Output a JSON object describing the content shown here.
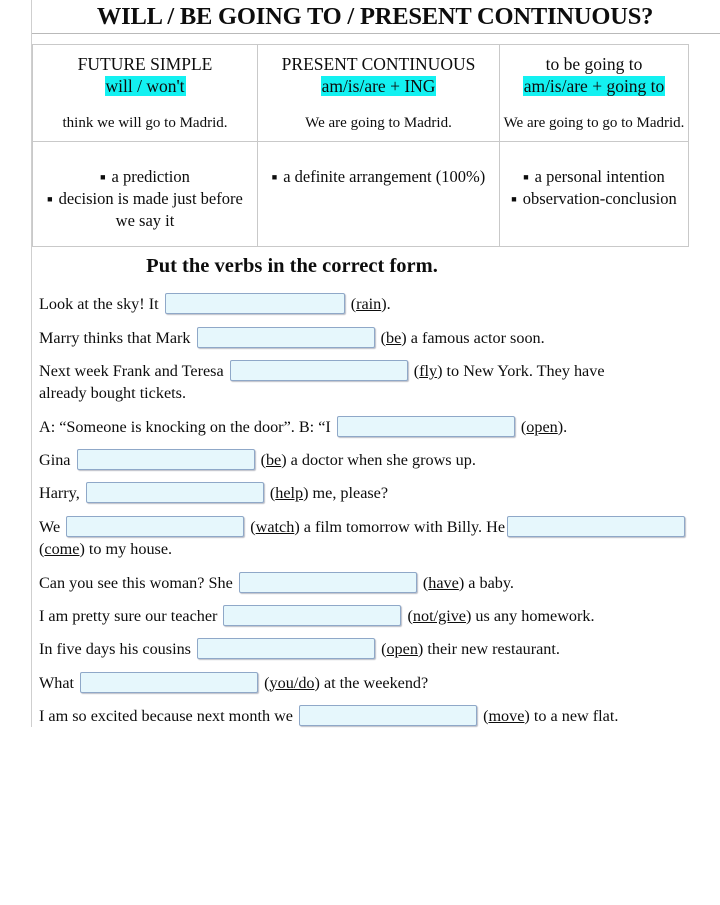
{
  "document": {
    "title": "WILL / BE GOING TO / PRESENT CONTINUOUS?"
  },
  "compare_table": {
    "columns": [
      {
        "name": "FUTURE SIMPLE",
        "form": "will / won't",
        "example": "think we will go to Madrid.",
        "uses": [
          "a prediction",
          "decision is made just before we say it"
        ]
      },
      {
        "name": "PRESENT CONTINUOUS",
        "form": "am/is/are + ING",
        "example": "We are going to Madrid.",
        "uses": [
          "a definite arrangement (100%)"
        ]
      },
      {
        "name": "to be going to",
        "form": "am/is/are + going to",
        "example": "We are going to go to Madrid.",
        "uses": [
          "a personal intention",
          "observation-conclusion"
        ]
      }
    ],
    "highlight_color": "#13f1f1"
  },
  "exercise": {
    "heading": "Put the verbs in the correct form.",
    "blank_fill": "#e6f7fc",
    "blank_border": "#8fa8c8",
    "questions": [
      {
        "before": "Look at  the sky! It",
        "blank_width": 180,
        "cue": "rain",
        "cue_underline": "ai",
        "after": ")."
      },
      {
        "before": "Marry thinks that Mark",
        "blank_width": 178,
        "cue": "be",
        "after": ") a famous actor soon."
      },
      {
        "before": "Next week Frank and Teresa",
        "blank_width": 178,
        "cue": "fly",
        "after": ") to New York. They have",
        "second_line": "already bought tickets."
      },
      {
        "before": "A: “Someone is knocking on the door”.  B: “I",
        "blank_width": 178,
        "cue": "open",
        "after": ")."
      },
      {
        "before": "Gina",
        "blank_width": 178,
        "cue": "be",
        "after": ") a doctor when she grows up."
      },
      {
        "before": "Harry,",
        "blank_width": 178,
        "cue": "help",
        "after": ") me, please?"
      },
      {
        "before": "We",
        "blank_width": 178,
        "cue": "watch",
        "after": ") a film tomorrow with Billy. He",
        "trailing_blank_width": 178,
        "second_line_cue": "come",
        "second_line_after": ") to my house."
      },
      {
        "before": "Can you see this woman? She",
        "blank_width": 178,
        "cue": "have",
        "after": ") a baby."
      },
      {
        "before": "I am pretty sure our teacher",
        "blank_width": 178,
        "cue": "not/give",
        "after": ") us any homework."
      },
      {
        "before": "In five days his cousins",
        "blank_width": 178,
        "cue": "open",
        "after": ") their new restaurant."
      },
      {
        "before": "What",
        "blank_width": 178,
        "cue": "you/do",
        "after": ") at  the weekend?"
      },
      {
        "before": "I am so excited because next month we",
        "blank_width": 178,
        "cue": "move",
        "after": ") to a new flat."
      }
    ]
  }
}
